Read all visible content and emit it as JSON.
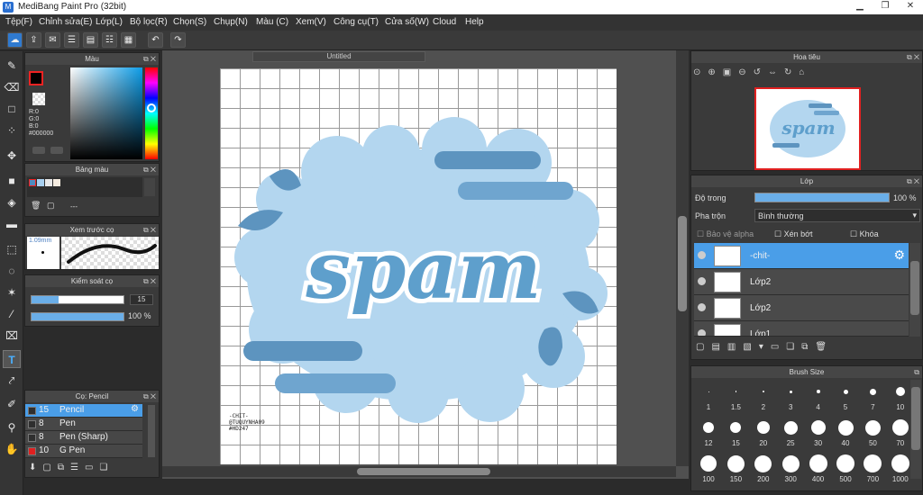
{
  "titlebar": {
    "title": "MediBang Paint Pro (32bit)"
  },
  "menu": [
    "Tệp(F)",
    "Chỉnh sửa(E)",
    "Lớp(L)",
    "Bộ lọc(R)",
    "Chọn(S)",
    "Chụp(N)",
    "Màu (C)",
    "Xem(V)",
    "Công cụ(T)",
    "Cửa số(W)",
    "Cloud",
    "Help"
  ],
  "document": {
    "tab": "Untitled"
  },
  "color_panel": {
    "title": "Màu",
    "r": "R:0",
    "g": "G:0",
    "b": "B:0",
    "hex": "#000000"
  },
  "palette_panel": {
    "title": "Bảng màu",
    "dash": "---"
  },
  "brush_preview": {
    "title": "Xem trước cọ",
    "size": "1.09mm"
  },
  "brush_control": {
    "title": "Kiểm soát cọ",
    "size": "15",
    "opacity": "100 %"
  },
  "brush_list": {
    "title": "Cọ: Pencil",
    "items": [
      {
        "size": "15",
        "name": "Pencil",
        "color": "#2f2f2f"
      },
      {
        "size": "8",
        "name": "Pen",
        "color": "#2f2f2f"
      },
      {
        "size": "8",
        "name": "Pen (Sharp)",
        "color": "#2f2f2f"
      },
      {
        "size": "10",
        "name": "G Pen",
        "color": "#e02020"
      }
    ]
  },
  "navigator": {
    "title": "Hoa tiêu"
  },
  "layers": {
    "title": "Lớp",
    "opacity_label": "Độ trong",
    "opacity_value": "100 %",
    "blend_label": "Pha trộn",
    "blend_value": "Bình thường",
    "protect_alpha": "Bảo vệ alpha",
    "clipping": "Xén bớt",
    "lock": "Khóa",
    "items": [
      {
        "name": "-chit-",
        "selected": true
      },
      {
        "name": "Lớp2",
        "selected": false
      },
      {
        "name": "Lớp2",
        "selected": false
      },
      {
        "name": "Lớp1",
        "selected": false
      }
    ]
  },
  "brush_size": {
    "title": "Brush Size",
    "sizes": [
      "1",
      "1.5",
      "2",
      "3",
      "4",
      "5",
      "7",
      "10",
      "12",
      "15",
      "20",
      "25",
      "30",
      "40",
      "50",
      "70",
      "100",
      "150",
      "200",
      "300",
      "400",
      "500",
      "700",
      "1000"
    ]
  },
  "artwork": {
    "word": "spam",
    "sig1": "-CHIT-",
    "sig2": "@TUQUYNHA09",
    "sig3": "#HD247"
  },
  "colors": {
    "accent": "#4a9ee8",
    "canvas_bg": "#ffffff",
    "cloud": "#b3d6ef",
    "bar": "#5d94bf",
    "letters": "#5e9fcc"
  }
}
